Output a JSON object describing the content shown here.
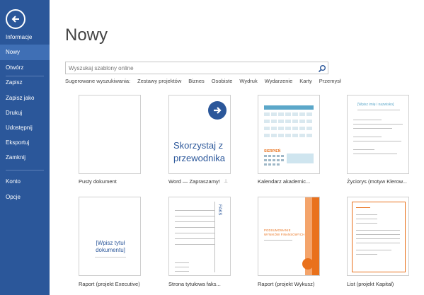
{
  "sidebar": {
    "back_icon": "arrow-left-icon",
    "items": [
      {
        "label": "Informacje"
      },
      {
        "label": "Nowy"
      },
      {
        "label": "Otwórz"
      },
      {
        "label": "Zapisz"
      },
      {
        "label": "Zapisz jako"
      },
      {
        "label": "Drukuj"
      },
      {
        "label": "Udostępnij"
      },
      {
        "label": "Eksportuj"
      },
      {
        "label": "Zamknij"
      },
      {
        "label": "Konto"
      },
      {
        "label": "Opcje"
      }
    ],
    "active_index": 1
  },
  "main": {
    "title": "Nowy",
    "search": {
      "placeholder": "Wyszukaj szablony online",
      "icon": "search-icon"
    },
    "suggestions": {
      "label": "Sugerowane wyszukiwania:",
      "links": [
        "Zestawy projektów",
        "Biznes",
        "Osobiste",
        "Wydruk",
        "Wydarzenie",
        "Karty",
        "Przemysł"
      ]
    },
    "templates": [
      {
        "label": "Pusty dokument"
      },
      {
        "label": "Word — Zapraszamy!",
        "thumb_text_1": "Skorzystaj z",
        "thumb_text_2": "przewodnika"
      },
      {
        "label": "Kalendarz akademic...",
        "thumb_text": "SIERPIEŃ"
      },
      {
        "label": "Życiorys (motyw Klerow...",
        "thumb_text": "[Wpisz imię i nazwisko]"
      },
      {
        "label": "Raport (projekt Executive)",
        "thumb_text_1": "[Wpisz tytuł",
        "thumb_text_2": "dokumentu]"
      },
      {
        "label": "Strona tytułowa faks...",
        "thumb_text": "FAKS"
      },
      {
        "label": "Raport (projekt Wykusz)",
        "thumb_text_1": "PODSUMOWANIE",
        "thumb_text_2": "WYNIKÓW FINANSOWYCH"
      },
      {
        "label": "List (projekt Kapitał)"
      }
    ]
  },
  "colors": {
    "accent": "#2b579a",
    "active_nav": "#3f6fb5",
    "orange": "#e9711c",
    "teal": "#5ba7c9"
  }
}
